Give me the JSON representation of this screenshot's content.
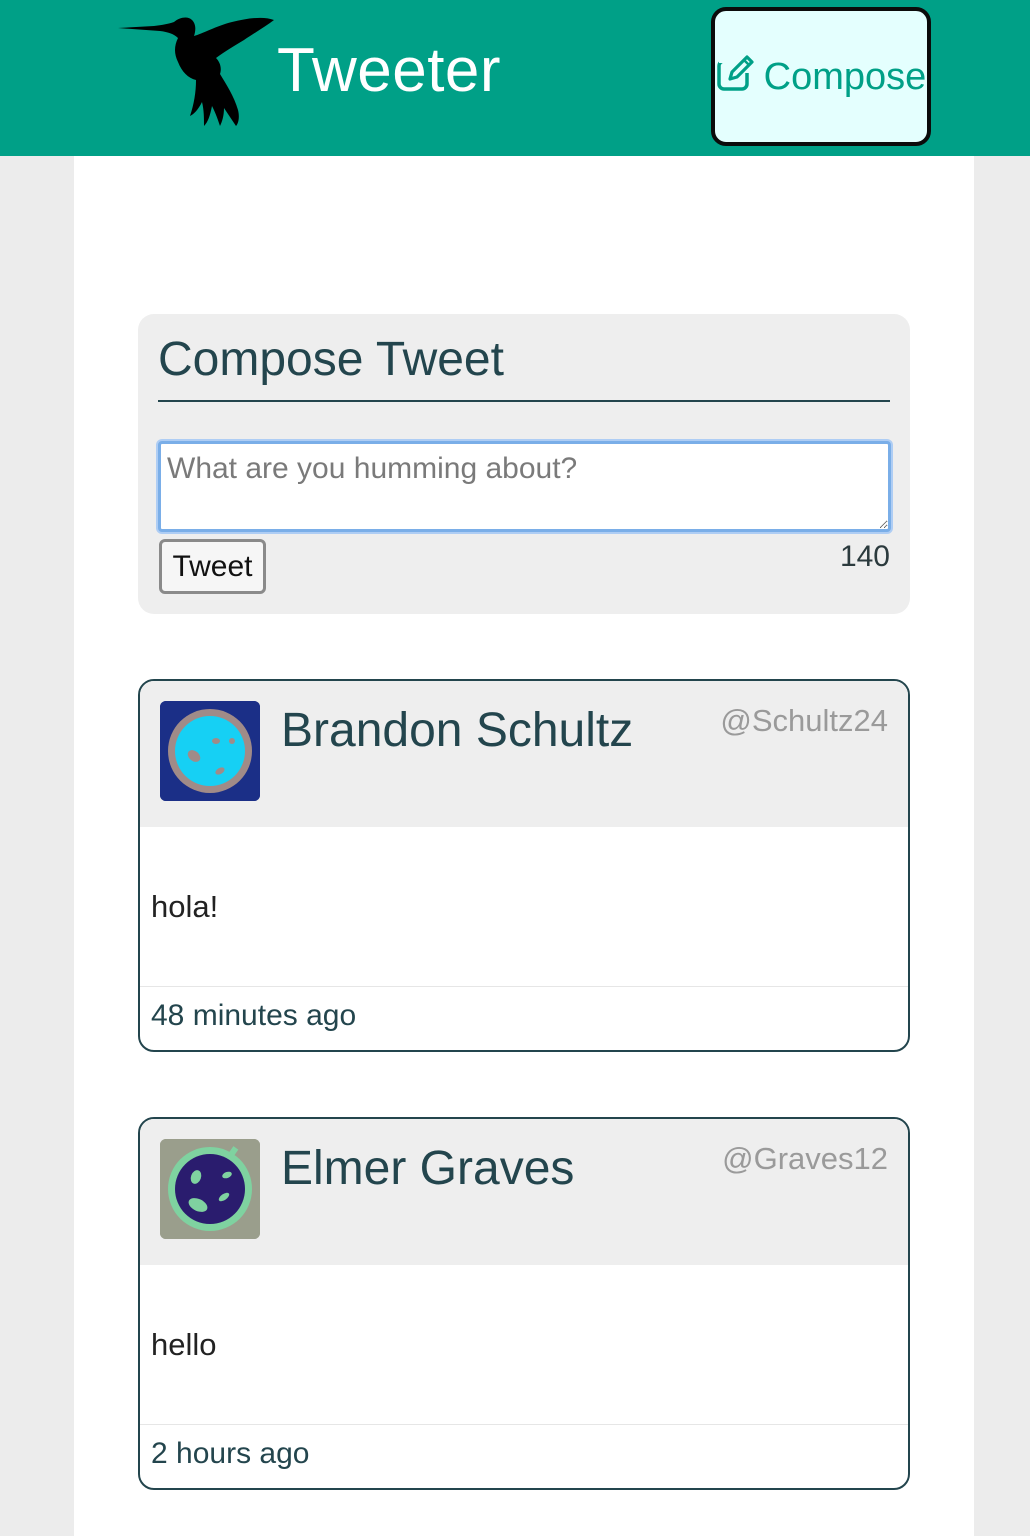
{
  "nav": {
    "brand": "Tweeter",
    "compose_label": "Compose",
    "logo_icon": "hummingbird-logo",
    "compose_icon": "edit-icon",
    "bg_color": "#00a087",
    "compose_bg": "#e4fffe"
  },
  "new_tweet": {
    "title": "Compose Tweet",
    "placeholder": "What are you humming about?",
    "value": "",
    "submit_label": "Tweet",
    "counter": "140"
  },
  "tweets": [
    {
      "name": "Brandon Schultz",
      "handle": "@Schultz24",
      "content": "hola!",
      "time": "48 minutes ago",
      "avatar_icon": "avatar-planet-blue",
      "avatar_bg": "#1b2f87"
    },
    {
      "name": "Elmer Graves",
      "handle": "@Graves12",
      "content": "hello",
      "time": "2 hours ago",
      "avatar_icon": "avatar-planet-purple",
      "avatar_bg": "#9a9e8c"
    }
  ],
  "colors": {
    "accent": "#00a087",
    "text_dark": "#23454d",
    "handle": "#9a9a9a",
    "page_bg": "#ececec"
  }
}
